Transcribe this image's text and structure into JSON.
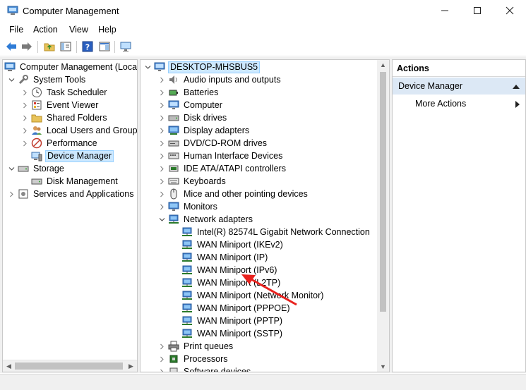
{
  "window": {
    "title": "Computer Management",
    "controls": [
      "minimize",
      "maximize",
      "close"
    ]
  },
  "menu": {
    "items": [
      "File",
      "Action",
      "View",
      "Help"
    ]
  },
  "toolbar": {
    "buttons": [
      "back-icon",
      "forward-icon",
      "up-folder-icon",
      "show-hide-tree-icon",
      "help-icon",
      "properties-icon",
      "monitor-icon"
    ]
  },
  "left_tree": {
    "root": "Computer Management (Local",
    "system_tools": "System Tools",
    "system_tools_children": [
      "Task Scheduler",
      "Event Viewer",
      "Shared Folders",
      "Local Users and Groups",
      "Performance",
      "Device Manager"
    ],
    "storage": "Storage",
    "storage_children": [
      "Disk Management"
    ],
    "services": "Services and Applications"
  },
  "device_tree": {
    "root": "DESKTOP-MHSBUS5",
    "categories_before": [
      "Audio inputs and outputs",
      "Batteries",
      "Computer",
      "Disk drives",
      "Display adapters",
      "DVD/CD-ROM drives",
      "Human Interface Devices",
      "IDE ATA/ATAPI controllers",
      "Keyboards",
      "Mice and other pointing devices",
      "Monitors"
    ],
    "expanded_category": "Network adapters",
    "network_adapters": [
      "Intel(R) 82574L Gigabit Network Connection",
      "WAN Miniport (IKEv2)",
      "WAN Miniport (IP)",
      "WAN Miniport (IPv6)",
      "WAN Miniport (L2TP)",
      "WAN Miniport (Network Monitor)",
      "WAN Miniport (PPPOE)",
      "WAN Miniport (PPTP)",
      "WAN Miniport (SSTP)"
    ],
    "categories_after": [
      "Print queues",
      "Processors",
      "Software devices"
    ]
  },
  "actions": {
    "header": "Actions",
    "section": "Device Manager",
    "more": "More Actions"
  },
  "annotation": {
    "color": "#e8221e"
  }
}
